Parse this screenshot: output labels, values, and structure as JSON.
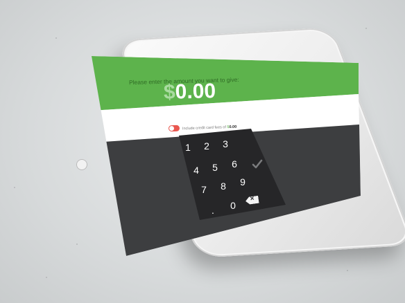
{
  "screen": {
    "prompt": "Please enter the amount you want to give:",
    "amount_currency": "$",
    "amount_value": "0.00",
    "fee_label": "Include credit card fees of",
    "fee_currency": "$",
    "fee_value": "0.00",
    "fee_toggle_on": false
  },
  "keypad": {
    "keys": [
      "1",
      "2",
      "3",
      "4",
      "5",
      "6",
      "7",
      "8",
      "9",
      ".",
      "0"
    ],
    "backspace_icon": "backspace-icon",
    "submit_icon": "checkmark-icon"
  },
  "colors": {
    "primary_green": "#5db34c",
    "dark_panel": "#3d3e40",
    "keypad_bg": "#262628",
    "toggle_red": "#e9574f"
  }
}
